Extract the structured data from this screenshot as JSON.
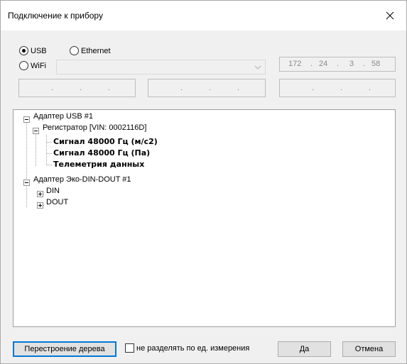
{
  "window": {
    "title": "Подключение к прибору"
  },
  "connection": {
    "usb_label": "USB",
    "ethernet_label": "Ethernet",
    "wifi_label": "WiFi",
    "selected": "USB",
    "wifi_network_value": "",
    "ip": {
      "a": "172",
      "b": "24",
      "c": "3",
      "d": "58"
    },
    "empty_ip_dots": "."
  },
  "tree": {
    "items": [
      {
        "label": "Адаптер USB #1",
        "bold": false,
        "expander": "minus"
      },
      {
        "label": "Регистратор [VIN: 0002116D]",
        "bold": false,
        "expander": "minus"
      },
      {
        "label": "Сигнал 48000 Гц (м/с2)",
        "bold": true
      },
      {
        "label": "Сигнал 48000 Гц (Па)",
        "bold": true
      },
      {
        "label": "Телеметрия данных",
        "bold": true
      },
      {
        "label": "Адаптер Эко-DIN-DOUT #1",
        "bold": false,
        "expander": "minus"
      },
      {
        "label": "DIN",
        "bold": false,
        "expander": "plus"
      },
      {
        "label": "DOUT",
        "bold": false,
        "expander": "plus"
      }
    ]
  },
  "footer": {
    "rebuild_label": "Перестроение дерева",
    "checkbox_label": "не разделять по ед. измерения",
    "checkbox_checked": false,
    "ok_label": "Да",
    "cancel_label": "Отмена"
  }
}
